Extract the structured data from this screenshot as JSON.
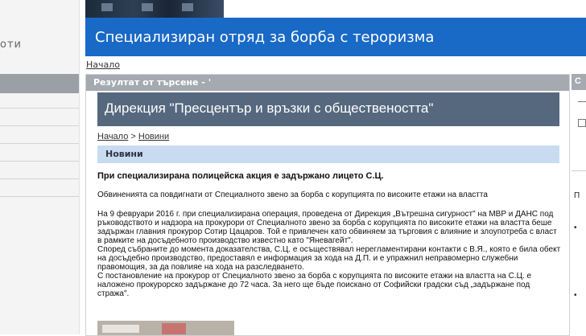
{
  "sidebar": {
    "brand_fragment": "оти"
  },
  "header": {
    "title": "Специализиран отряд за борба с тероризма"
  },
  "top_breadcrumb": "Начало",
  "panel": {
    "heading": "Резултат от търсене - '"
  },
  "directorate": {
    "title": "Дирекция \"Пресцентър и връзки с обществеността\""
  },
  "breadcrumb": {
    "home": "Начало",
    "separator": " > ",
    "current": "Новини"
  },
  "news_bar": {
    "label": "Новини"
  },
  "article": {
    "title": "При специализирана полицейска акция е задържано лицето С.Ц.",
    "subtitle": "Обвиненията са повдигнати от Специалното звено за борба с корупцията по високите етажи на властта",
    "paragraphs": [
      "На 9 февруари 2016 г. при специализирана операция, проведена от  Дирекция „Вътрешна сигурност\" на МВР и ДАНС под ръководството и надзора на прокурори от Специалното звено за борба с корупцията по високите етажи на властта беше задържан главния прокурор Сотир Цацаров. Той е привлечен като обвиняем за търговия с влияние и злоупотреба с власт в рамките на досъдебното производство известно като \"Яневагейт\".",
      "Според събраните до момента доказателства, С.Ц. е осъществявал нерегламентирани контакти с В.Я., която е била обект на досъдебно производство, предоставял е информация за хода на Д.П. и е упражнил неправомерно служебни правомощия, за да повлияе на хода на разследването.",
      "С постановление на прокурор от Специалното звено за борба с корупцията по високите етажи на властта на С.Ц. е наложено прокурорско задържане до 72 часа. За него ще бъде поискано от Софийски градски съд „задържане под стража\"."
    ]
  },
  "right": {
    "head": "С",
    "frag1": "П",
    "frag2": "•",
    "frag3": "•"
  }
}
